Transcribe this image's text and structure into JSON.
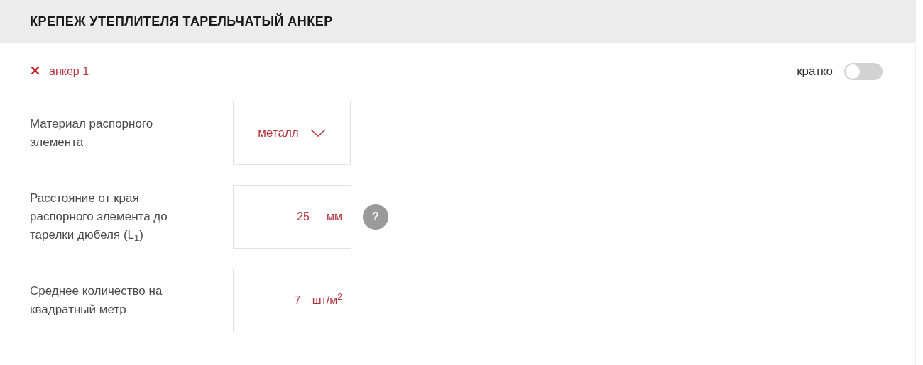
{
  "header": {
    "title": "КРЕПЕЖ УТЕПЛИТЕЛЯ ТАРЕЛЬЧАТЫЙ АНКЕР"
  },
  "item": {
    "remove_icon": "✕",
    "name": "анкер 1"
  },
  "brief_toggle": {
    "label": "кратко",
    "on": false
  },
  "fields": [
    {
      "kind": "select",
      "label": "Материал распорного элемента",
      "value": "металл"
    },
    {
      "kind": "number",
      "label": "Расстояние от края распорного элемента до тарелки дюбеля (L$_{1}$)",
      "value": "25",
      "unit": "мм",
      "help": "?"
    },
    {
      "kind": "number",
      "label": "Среднее количество на квадратный метр",
      "value": "7",
      "unit": "шт/м$^{2}$"
    }
  ]
}
